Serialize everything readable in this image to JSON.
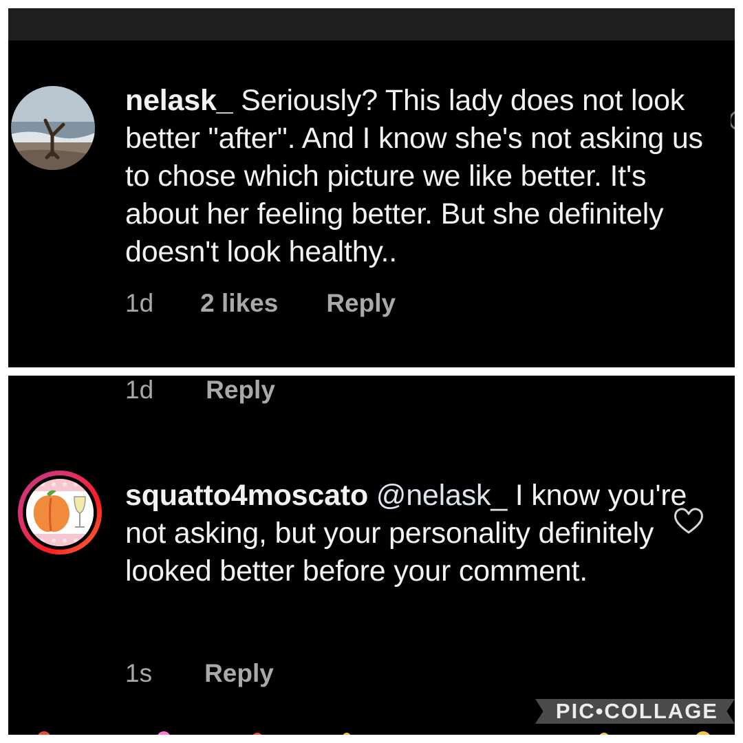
{
  "comments": [
    {
      "username": "nelask_",
      "text": " Seriously? This lady does not look better \"after\". And I know she's not asking us to chose which picture we like better. It's about her feeling better. But she definitely doesn't look healthy..",
      "time": "1d",
      "likes": "2 likes",
      "reply": "Reply"
    },
    {
      "time": "1d",
      "reply": "Reply"
    },
    {
      "username": "squatto4moscato",
      "mention": "@nelask_",
      "text": " I know you're not asking, but your personality definitely looked better before your comment.",
      "time": "1s",
      "reply": "Reply"
    }
  ],
  "brand": {
    "label": "PIC•COLLAGE"
  },
  "icons": {
    "heart": "heart-icon",
    "avatar1": "beach-handstand-avatar",
    "avatar2": "peach-wine-avatar"
  },
  "colors": {
    "background": "#000000",
    "text": "#f2f2f2",
    "meta_text": "#a9a9a9",
    "story_ring": "#e1306c"
  }
}
